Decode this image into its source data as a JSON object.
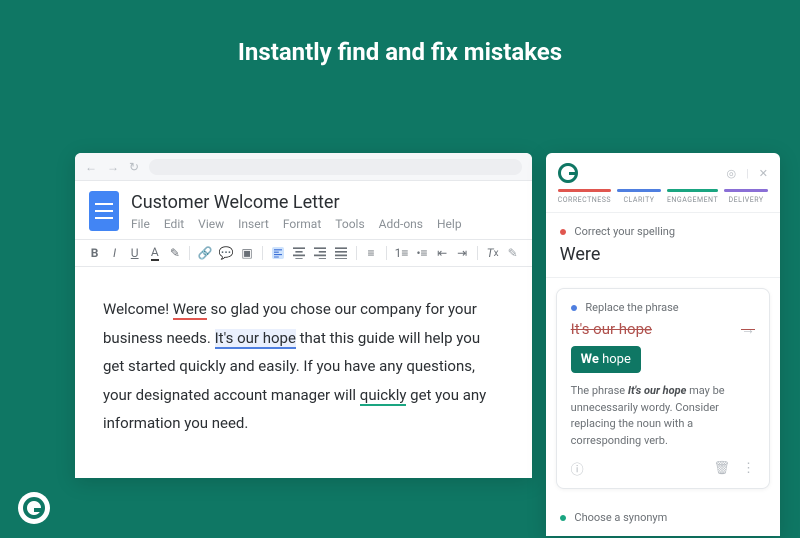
{
  "hero": {
    "title": "Instantly find and fix mistakes"
  },
  "doc": {
    "title": "Customer Welcome Letter",
    "menus": [
      "File",
      "Edit",
      "View",
      "Insert",
      "Format",
      "Tools",
      "Add-ons",
      "Help"
    ],
    "body_parts": {
      "p1a": "Welcome! ",
      "err_were": "Were",
      "p1b": " so glad you chose our company for your business needs. ",
      "err_hope": "It's our hope",
      "p1c": " that this guide will help you get started quickly and easily. If you have any questions, your designated account manager will ",
      "err_quickly": "quickly",
      "p1d": " get you any information you need."
    }
  },
  "panel": {
    "tabs": [
      {
        "label": "CORRECTNESS",
        "color": "#e0564f"
      },
      {
        "label": "CLARITY",
        "color": "#4f7fe0"
      },
      {
        "label": "ENGAGEMENT",
        "color": "#1aa581"
      },
      {
        "label": "DELIVERY",
        "color": "#8a6fd6"
      }
    ],
    "card_spell": {
      "dot_color": "#e0564f",
      "title": "Correct your spelling",
      "word": "Were"
    },
    "card_replace": {
      "dot_color": "#4f7fe0",
      "title": "Replace the phrase",
      "strike": "It's our hope",
      "suggestion_bold": "We",
      "suggestion_rest": " hope",
      "explain_pre": "The phrase ",
      "explain_bold": "It's our hope",
      "explain_post": " may be unnecessarily wordy. Consider replacing the noun with a corresponding verb."
    },
    "card_synonym": {
      "dot_color": "#1aa581",
      "title": "Choose a synonym"
    }
  }
}
